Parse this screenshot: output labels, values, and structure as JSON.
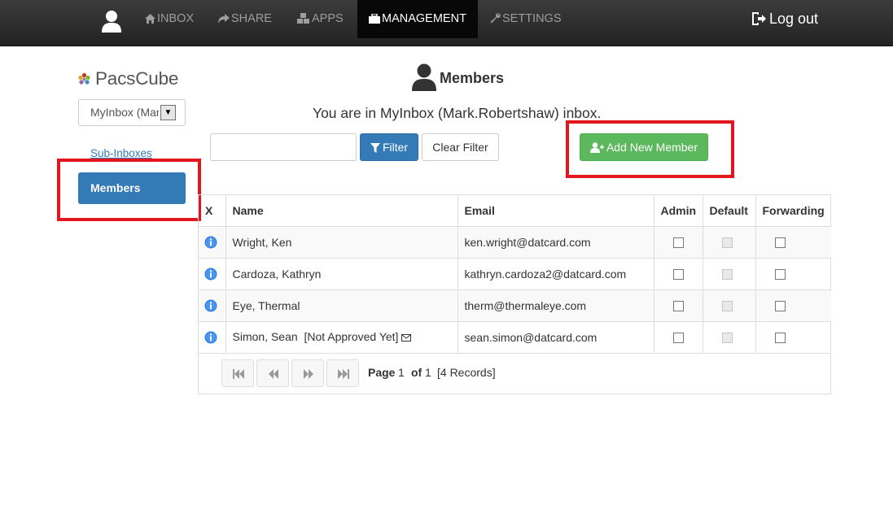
{
  "nav": {
    "items": [
      {
        "label": "INBOX",
        "icon": "home-icon"
      },
      {
        "label": "SHARE",
        "icon": "share-icon"
      },
      {
        "label": "APPS",
        "icon": "cubes-icon"
      },
      {
        "label": "MANAGEMENT",
        "icon": "briefcase-icon",
        "active": true
      },
      {
        "label": "SETTINGS",
        "icon": "wrench-icon"
      }
    ],
    "logout_label": "Log out"
  },
  "sidebar": {
    "logo_text": "PacsCube",
    "inbox_select_value": "MyInbox (Mark.Robertshaw)",
    "sub_inboxes_label": "Sub-Inboxes",
    "members_label": "Members"
  },
  "page": {
    "title": "Members",
    "inbox_info": "You are in MyInbox (Mark.Robertshaw) inbox."
  },
  "toolbar": {
    "filter_value": "",
    "filter_label": "Filter",
    "clear_filter_label": "Clear Filter",
    "add_member_label": "Add New Member"
  },
  "table": {
    "headers": {
      "x": "X",
      "name": "Name",
      "email": "Email",
      "admin": "Admin",
      "default": "Default",
      "forwarding": "Forwarding"
    },
    "rows": [
      {
        "name": "Wright, Ken",
        "status": "",
        "email": "ken.wright@datcard.com",
        "admin": false,
        "default": false,
        "forwarding": false
      },
      {
        "name": "Cardoza, Kathryn",
        "status": "",
        "email": "kathryn.cardoza2@datcard.com",
        "admin": false,
        "default": false,
        "forwarding": false
      },
      {
        "name": "Eye, Thermal",
        "status": "",
        "email": "therm@thermaleye.com",
        "admin": false,
        "default": false,
        "forwarding": false
      },
      {
        "name": "Simon, Sean",
        "status": "[Not Approved Yet]",
        "email": "sean.simon@datcard.com",
        "admin": false,
        "default": false,
        "forwarding": false
      }
    ]
  },
  "pager": {
    "page_label": "Page",
    "current_page": "1",
    "of_label": "of",
    "total_pages": "1",
    "records": "[4 Records]"
  },
  "colors": {
    "navbar": "#2a2a2a",
    "primary": "#337ab7",
    "success": "#5cb85c",
    "highlight": "#e3161f"
  }
}
